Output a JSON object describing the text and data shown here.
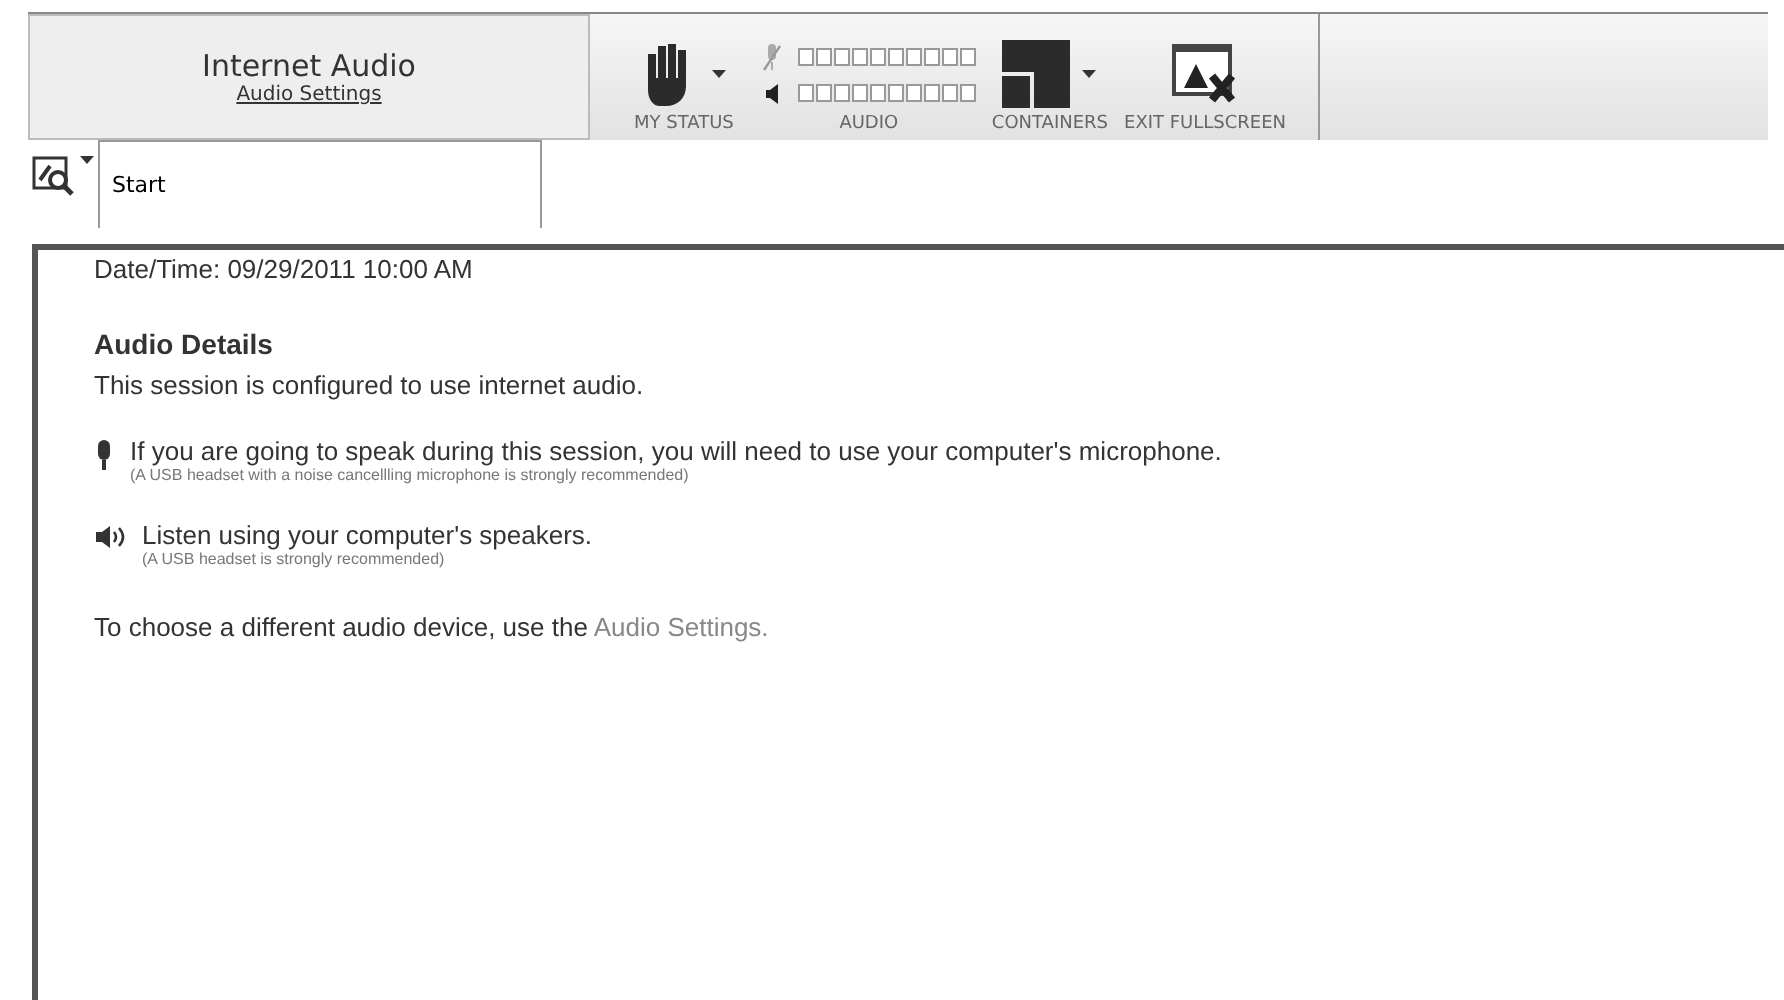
{
  "audio_panel": {
    "title": "Internet Audio",
    "link": "Audio Settings"
  },
  "toolbar": [
    {
      "kind": "status",
      "label": "MY STATUS",
      "dropdown": true
    },
    {
      "kind": "audio",
      "label": "AUDIO",
      "mic_muted": true,
      "meters": [
        {
          "level": 0
        },
        {
          "level": 0
        }
      ]
    },
    {
      "kind": "containers",
      "label": "CONTAINERS",
      "dropdown": true
    },
    {
      "kind": "exit",
      "label": "EXIT FULLSCREEN",
      "dropdown": false
    }
  ],
  "search": {
    "value": "Start"
  },
  "content": {
    "datetime": "Date/Time: 09/29/2011 10:00 AM",
    "heading": "Audio Details",
    "intro": "This session is configured to use internet audio.",
    "options": [
      {
        "kind": "microphone",
        "text": "If you are going to speak during this session, you will need to use your computer's microphone.",
        "note": "(A USB headset with a noise cancellling microphone is strongly recommended)"
      },
      {
        "kind": "speaker",
        "text": "Listen using your computer's speakers.",
        "note": "(A USB headset is strongly recommended)"
      }
    ],
    "footer_text": "To choose a different audio device, use the",
    "footer_link": "Audio Settings."
  }
}
